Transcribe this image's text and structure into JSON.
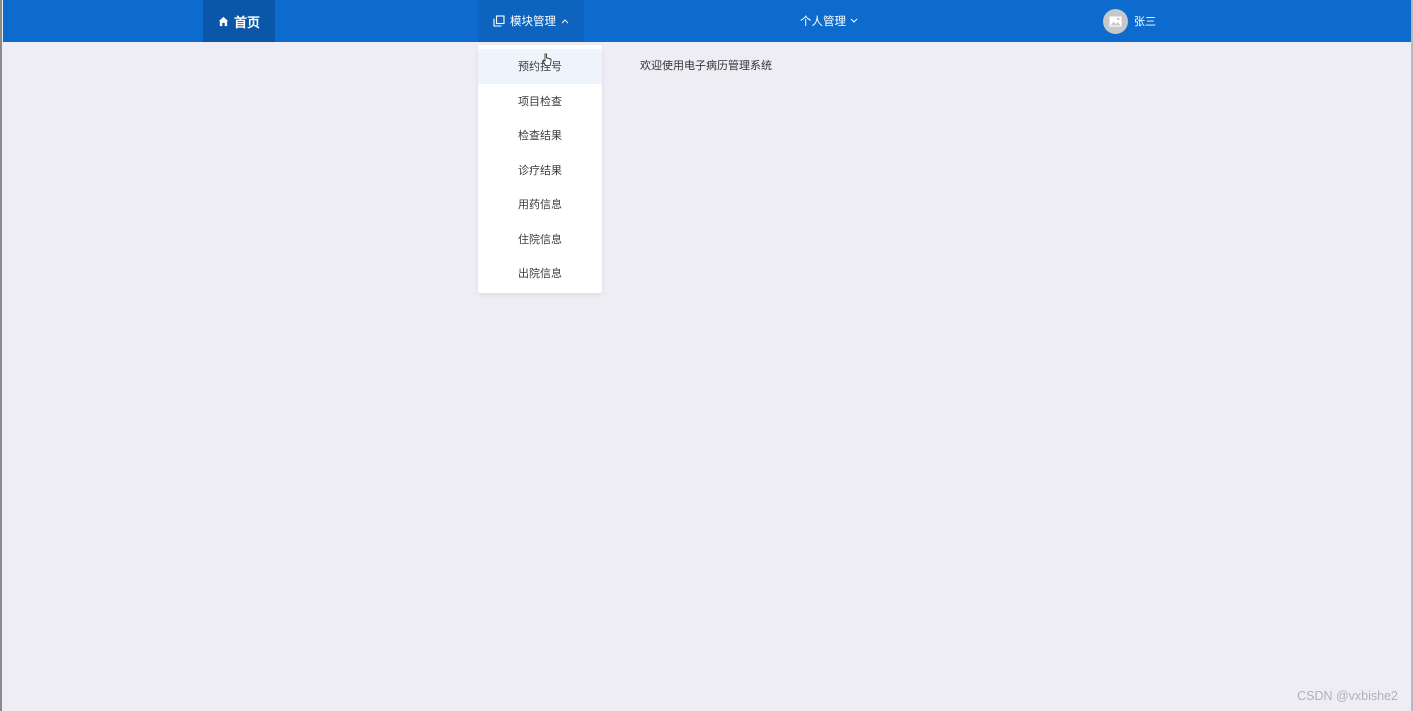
{
  "nav": {
    "home_label": "首页",
    "module_label": "模块管理",
    "personal_label": "个人管理",
    "user_name": "张三"
  },
  "dropdown": {
    "items": [
      {
        "label": "预约挂号"
      },
      {
        "label": "项目检查"
      },
      {
        "label": "检查结果"
      },
      {
        "label": "诊疗结果"
      },
      {
        "label": "用药信息"
      },
      {
        "label": "住院信息"
      },
      {
        "label": "出院信息"
      }
    ]
  },
  "main": {
    "welcome_text": "欢迎使用电子病历管理系统"
  },
  "watermark": "CSDN @vxbishe2",
  "icons": {
    "home": "home-icon",
    "module": "copy-icon",
    "module_caret": "chevron-up-icon",
    "personal_caret": "chevron-down-icon",
    "avatar": "image-placeholder-icon",
    "cursor": "hand-cursor-icon"
  },
  "colors": {
    "topbar": "#0c6bcd",
    "home_active": "#0a56a8",
    "module_active": "#0e63be",
    "background": "#efedf4",
    "dropdown_hover": "#eef4fc"
  }
}
